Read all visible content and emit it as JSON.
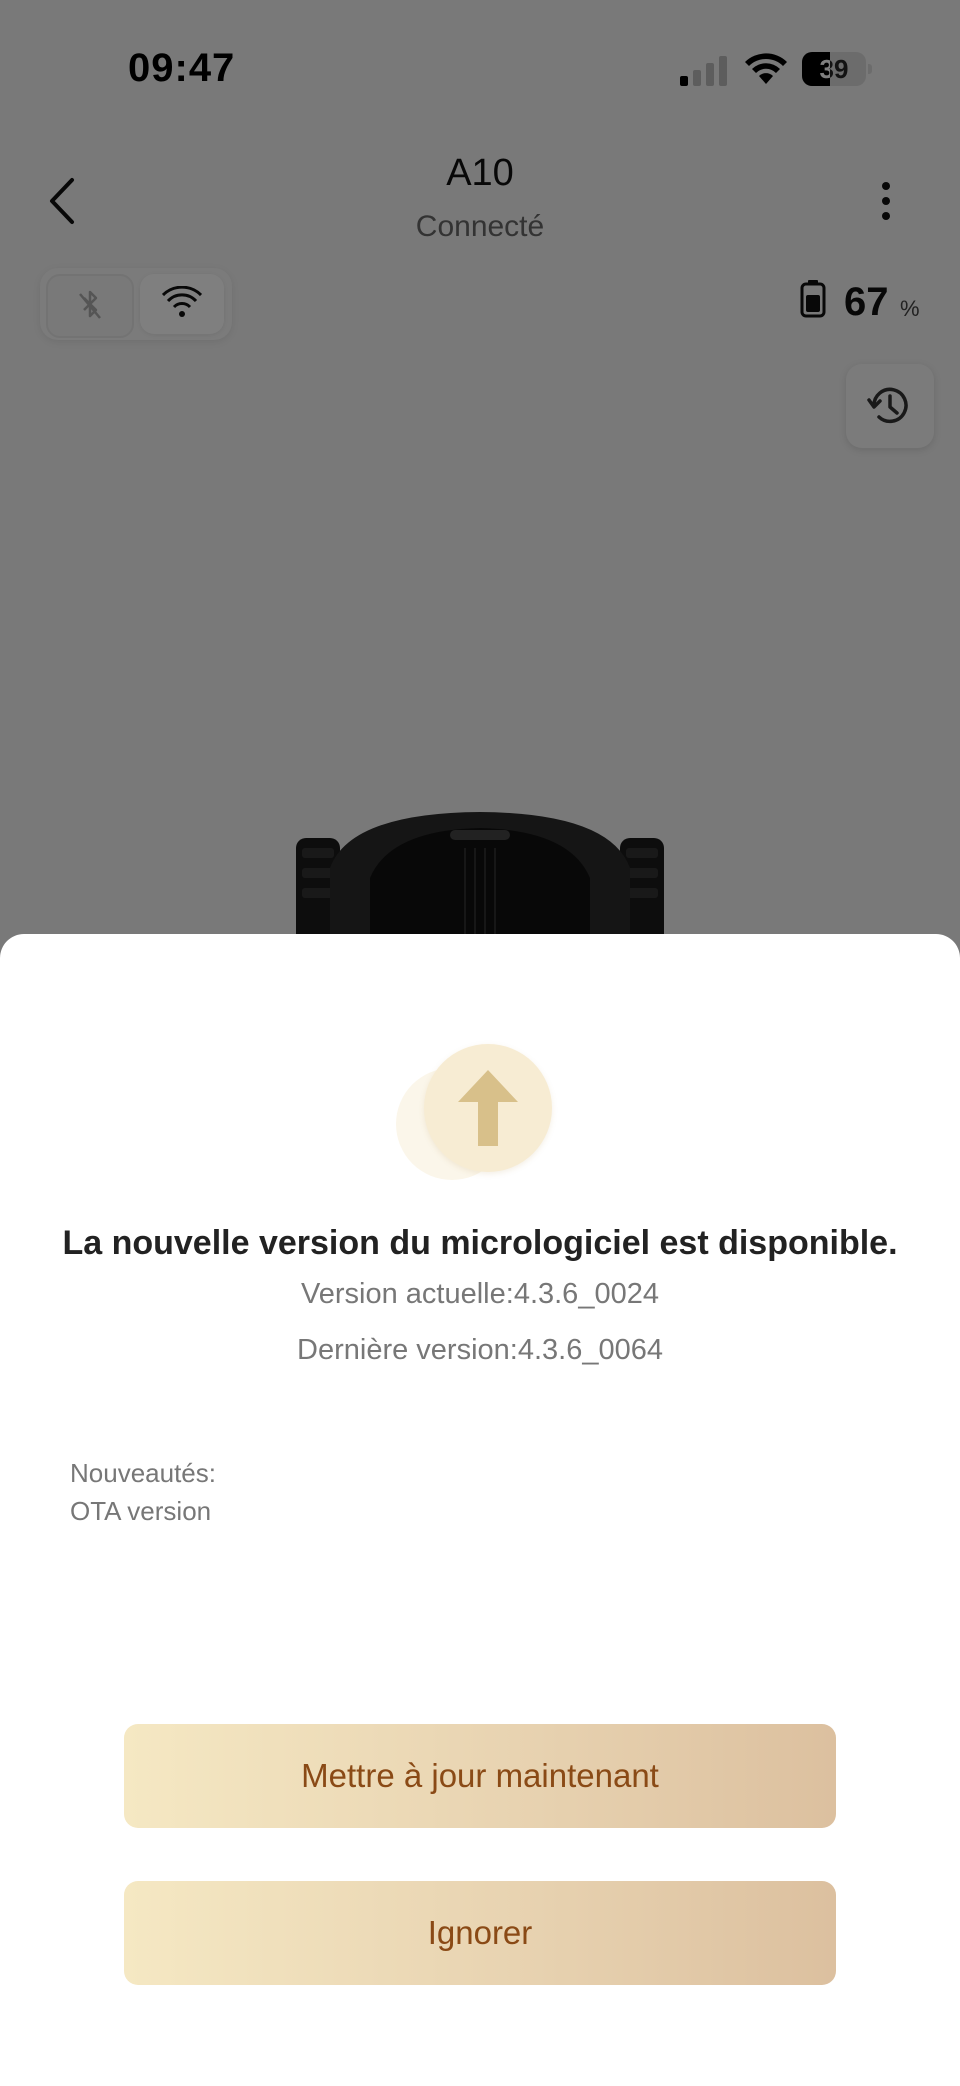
{
  "status_bar": {
    "time": "09:47",
    "battery_level": "39"
  },
  "header": {
    "title": "A10",
    "subtitle": "Connecté"
  },
  "connection": {
    "bluetooth_active": false,
    "wifi_active": true
  },
  "device_battery": {
    "value": "67",
    "unit": "%"
  },
  "update_sheet": {
    "title": "La nouvelle version du micrologiciel est disponible.",
    "current_version": "Version actuelle:4.3.6_0024",
    "latest_version": "Dernière version:4.3.6_0064",
    "notes_label": "Nouveautés:",
    "notes_text": "OTA version",
    "update_button": "Mettre à jour maintenant",
    "ignore_button": "Ignorer"
  },
  "colors": {
    "button_gradient_start": "#f5e8c3",
    "button_gradient_end": "#dcc09f",
    "button_text": "#8a4a16",
    "icon_gold": "#d8c08a"
  }
}
